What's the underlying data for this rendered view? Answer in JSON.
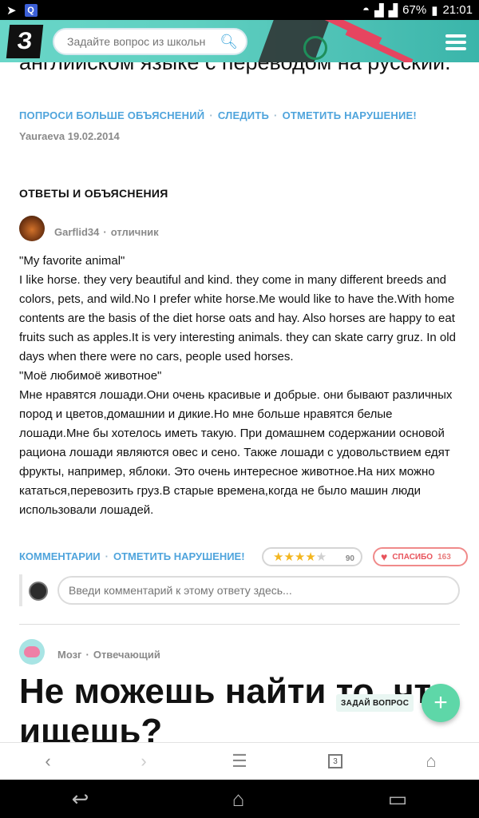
{
  "status_bar": {
    "network": "67%",
    "time": "21:01"
  },
  "header": {
    "logo": "З",
    "search_placeholder": "Задайте вопрос из школьн"
  },
  "question": {
    "title_partial": "английском языке с переводом на русский.",
    "actions": [
      "ПОПРОСИ БОЛЬШЕ ОБЪЯСНЕНИЙ",
      "СЛЕДИТЬ",
      "ОТМЕТИТЬ НАРУШЕНИЕ!"
    ],
    "meta": "Yauraeva 19.02.2014"
  },
  "answers_section": {
    "title": "ОТВЕТЫ И ОБЪЯСНЕНИЯ"
  },
  "answer1": {
    "author": "Garflid34",
    "rank": "отличник",
    "lines": [
      "\"My favorite animal\"",
      "I like horse. they very beautiful and kind. they come in many different breeds and colors, pets, and wild.No I prefer white horse.Me would like to have the.With home contents are the basis of the diet horse oats and hay. Also horses are happy to eat fruits such as apples.It is very interesting animals. they can skate carry gruz. In old days when there were no cars, people used horses.",
      "\"Моё любимоё животное\"",
      "Мне нравятся лошади.Они очень красивые и добрые. они бывают различных пород и цветов,домашнии и дикие.Но мне больше нравятся белые лошади.Мне бы хотелось иметь такую. При домашнем содержании основой рациона лошади являются овес и сено. Также лошади с удовольствием едят фрукты, например, яблоки. Это очень интересное животное.На них можно кататься,перевозить груз.В старые времена,когда не было машин люди использовали лошадей."
    ],
    "actions": [
      "КОММЕНТАРИИ",
      "ОТМЕТИТЬ НАРУШЕНИЕ!"
    ],
    "rating_stars": 4,
    "rating_count": "90",
    "thanks_label": "СПАСИБО",
    "thanks_count": "163",
    "comment_placeholder": "Введи комментарий к этому ответу здесь..."
  },
  "answer2": {
    "author": "Мозг",
    "rank": "Отвечающий"
  },
  "promo": {
    "title": "Не можешь найти то, что ищешь?",
    "ask_button_label": "ЗАДАЙ ВОПРОС"
  },
  "browser_bar": {
    "tab_count": "3"
  },
  "colors": {
    "link": "#4fa4dc",
    "fab": "#5ed7a8",
    "thanks": "#e8545c",
    "star": "#f3b61f"
  }
}
